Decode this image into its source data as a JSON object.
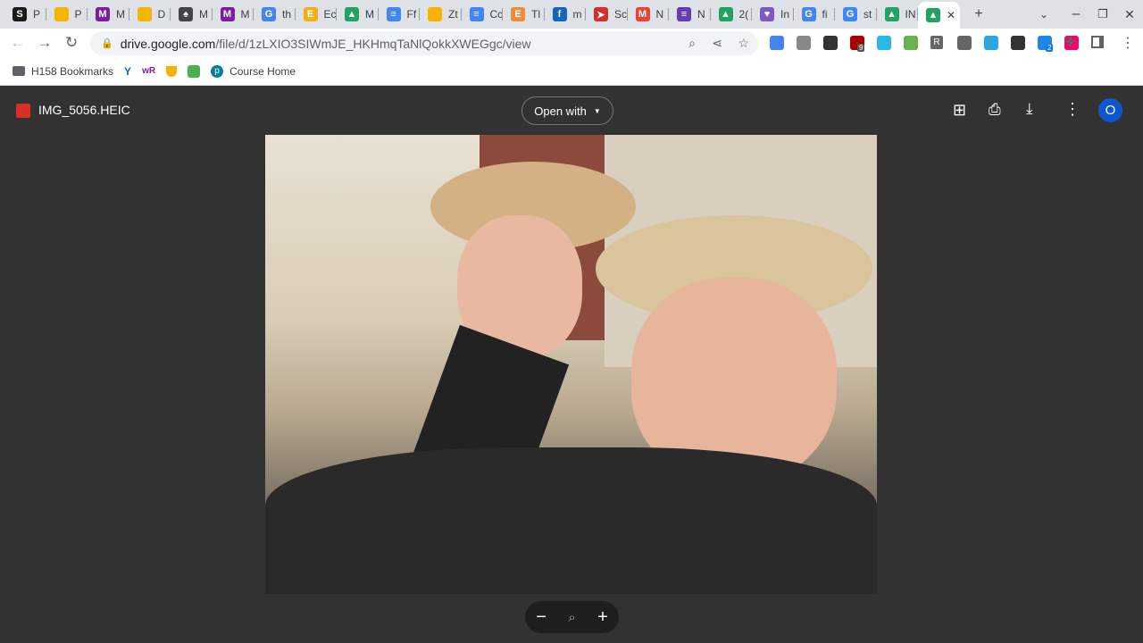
{
  "tabs": [
    {
      "icon": "s-icon",
      "color": "#1a1a1a",
      "glyph": "S",
      "title": "P"
    },
    {
      "icon": "slides-icon",
      "color": "#f4b400",
      "glyph": "",
      "title": "P"
    },
    {
      "icon": "m-icon",
      "color": "#7b1fa2",
      "glyph": "M",
      "title": "M"
    },
    {
      "icon": "slides-icon",
      "color": "#f4b400",
      "glyph": "",
      "title": "D"
    },
    {
      "icon": "acorn-icon",
      "color": "#444",
      "glyph": "♠",
      "title": "M"
    },
    {
      "icon": "m-icon",
      "color": "#7b1fa2",
      "glyph": "M",
      "title": "M"
    },
    {
      "icon": "google-icon",
      "color": "#4285f4",
      "glyph": "G",
      "title": "th"
    },
    {
      "icon": "edpuzzle-icon",
      "color": "#f2b01e",
      "glyph": "E",
      "title": "Ec"
    },
    {
      "icon": "drive-icon",
      "color": "#1fa463",
      "glyph": "▲",
      "title": "M"
    },
    {
      "icon": "docs-icon",
      "color": "#4285f4",
      "glyph": "≡",
      "title": "Ff"
    },
    {
      "icon": "slides-icon",
      "color": "#f4b400",
      "glyph": "",
      "title": "Zt"
    },
    {
      "icon": "docs-icon",
      "color": "#4285f4",
      "glyph": "≡",
      "title": "Cc"
    },
    {
      "icon": "e-icon",
      "color": "#f08a3c",
      "glyph": "E",
      "title": "Tl"
    },
    {
      "icon": "f-icon",
      "color": "#1565c0",
      "glyph": "f",
      "title": "m"
    },
    {
      "icon": "arrow-icon",
      "color": "#d32f2f",
      "glyph": "➤",
      "title": "Sc"
    },
    {
      "icon": "gmail-icon",
      "color": "#ea4335",
      "glyph": "M",
      "title": "N"
    },
    {
      "icon": "forms-icon",
      "color": "#673ab7",
      "glyph": "≡",
      "title": "N"
    },
    {
      "icon": "drive-icon",
      "color": "#1fa463",
      "glyph": "▲",
      "title": "2("
    },
    {
      "icon": "purple-icon",
      "color": "#7e57c2",
      "glyph": "♥",
      "title": "In"
    },
    {
      "icon": "google-icon",
      "color": "#4285f4",
      "glyph": "G",
      "title": "fi"
    },
    {
      "icon": "google-icon",
      "color": "#4285f4",
      "glyph": "G",
      "title": "st"
    },
    {
      "icon": "drive-icon",
      "color": "#1fa463",
      "glyph": "▲",
      "title": "IN"
    }
  ],
  "active_tab": {
    "close": "✕",
    "glyph": "▲",
    "color": "#1fa463"
  },
  "url": {
    "domain": "drive.google.com",
    "path": "/file/d/1zLXIO3SIWmJE_HKHmqTaNlQokkXWEGgc/view"
  },
  "extensions": [
    "#4285f4",
    "#888",
    "#333",
    "#a00",
    "#2bb7e8",
    "#6ab04c",
    "#666",
    "#29a8e0",
    "#333",
    "#1e88e5",
    "#f06"
  ],
  "ext_badges": {
    "ublock": "9",
    "last": "2"
  },
  "ext_r": "R",
  "bookmarks": [
    {
      "label": "H158 Bookmarks"
    },
    {
      "label": ""
    },
    {
      "label": ""
    },
    {
      "label": ""
    },
    {
      "label": ""
    },
    {
      "label": "Course Home"
    }
  ],
  "bm_wr": "wR",
  "viewer": {
    "filename": "IMG_5056.HEIC",
    "open_with": "Open with",
    "avatar": "O",
    "accent": "#0b57d0"
  }
}
